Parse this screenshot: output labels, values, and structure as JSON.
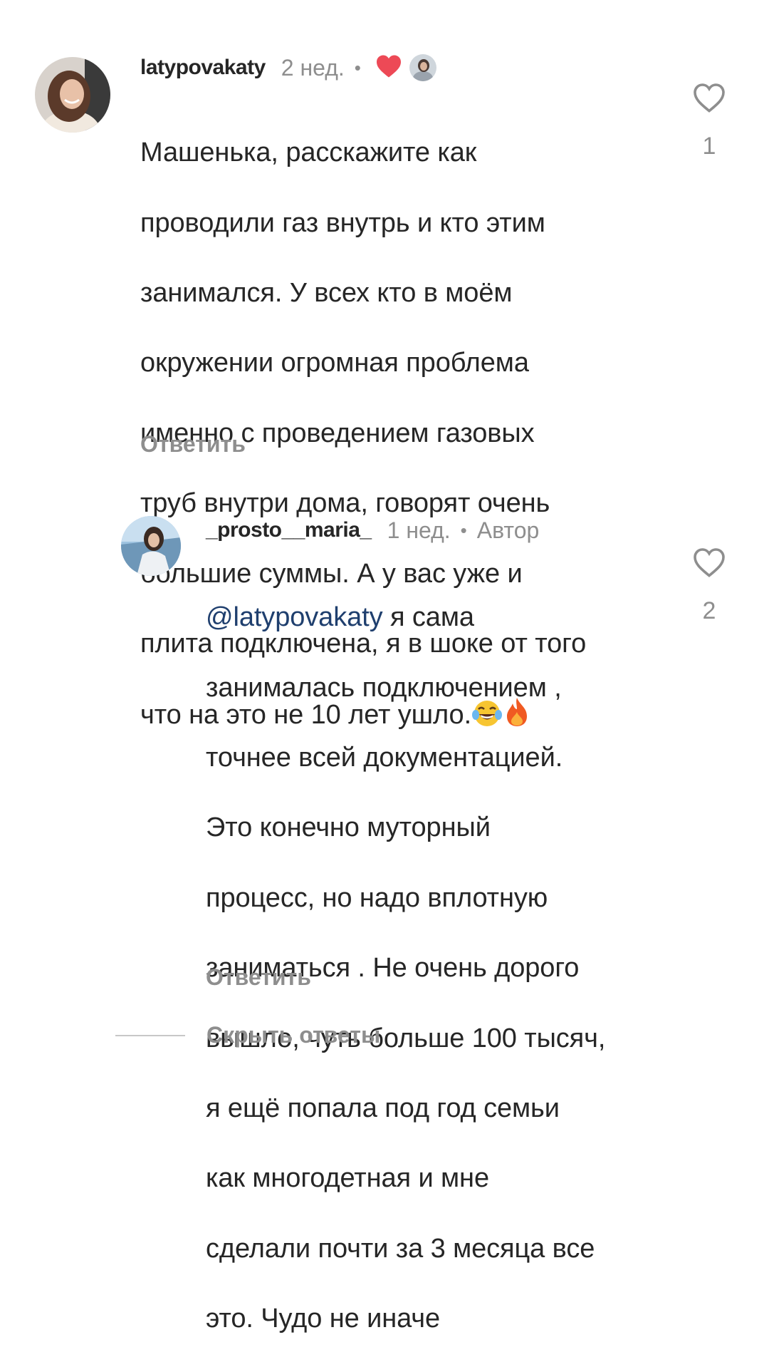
{
  "comments": [
    {
      "username": "latypovakaty",
      "time": "2 нед.",
      "text_lines": [
        "Машенька, расскажите как",
        "проводили газ внутрь и кто этим",
        "занимался. У всех кто в моём",
        "окружении огромная проблема",
        "именно с проведением газовых",
        "труб внутри дома, говорят очень",
        "большие суммы. А у вас уже и",
        "плита подключена, я в шоке от того",
        "что на это не 10 лет ушло."
      ],
      "emoji_icons": [
        "tears-of-joy-emoji-icon",
        "fire-emoji-icon"
      ],
      "like_count": "1",
      "reply_label": "Ответить",
      "author_liked": true
    },
    {
      "username": "_prosto__maria_",
      "time": "1 нед.",
      "badge": "Автор",
      "mention": "@latypovakaty",
      "text_first_rest": " я сама",
      "text_lines": [
        "занималась подключением ,",
        "точнее всей документацией.",
        "Это конечно муторный",
        "процесс, но надо вплотную",
        "заниматься . Не очень дорого",
        "вышло, чуть больше 100 тысяч,",
        "я ещё попала под год семьи",
        "как многодетная и мне",
        "сделали почти за 3 месяца все",
        "это. Чудо не иначе"
      ],
      "like_count": "2",
      "reply_label": "Ответить"
    }
  ],
  "hide_replies_label": "Скрыть ответы",
  "colors": {
    "text": "#262626",
    "secondary": "#8e8e8e",
    "like_red": "#ed4956",
    "mention": "#1f3f6e"
  }
}
